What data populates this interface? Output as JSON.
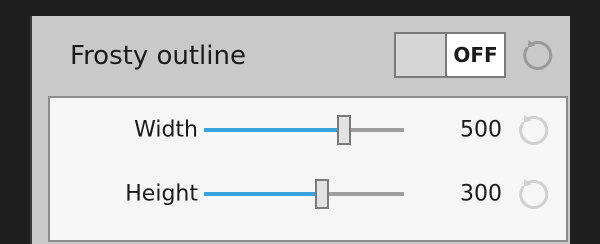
{
  "section": {
    "title": "Frosty outline",
    "toggle": {
      "state_label": "OFF",
      "on": false
    }
  },
  "settings": [
    {
      "label": "Width",
      "value": "500",
      "slider_fraction": 0.7
    },
    {
      "label": "Height",
      "value": "300",
      "slider_fraction": 0.59
    }
  ],
  "colors": {
    "accent": "#3aa3de",
    "reset_icon_header": "#9a9a9a",
    "reset_icon_rows": "#d0d0d0"
  },
  "icons": {
    "reset": "reset-icon"
  }
}
